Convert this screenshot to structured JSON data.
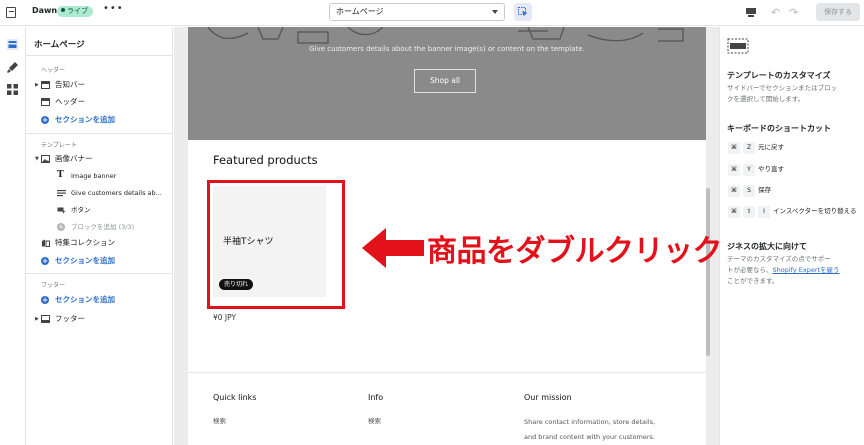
{
  "topbar": {
    "store_name": "Dawn",
    "status_badge": "ライブ",
    "more_label": "•••",
    "page_select": "ホームページ",
    "undo": "↶",
    "redo": "↷",
    "save_label": "保存する"
  },
  "sidebar": {
    "title": "ホームページ",
    "header_group": "ヘッダー",
    "header_items": [
      "告知バー",
      "ヘッダー"
    ],
    "add_section": "セクションを追加",
    "template_group": "テンプレート",
    "image_banner": "画像バナー",
    "banner_children": [
      "Image banner",
      "Give customers details ab...",
      "ボタン"
    ],
    "add_block": "ブロックを追加 (3/3)",
    "featured_collection": "特集コレクション",
    "add_section_2": "セクションを追加",
    "footer_group": "フッター",
    "add_section_3": "セクションを追加",
    "footer_item": "フッター"
  },
  "preview": {
    "banner_text": "Give customers details about the banner image(s) or content on the template.",
    "banner_button": "Shop all",
    "featured_title": "Featured products",
    "product_name": "半袖Tシャツ",
    "sold_out": "売り切れ",
    "price": "¥0 JPY",
    "footer": {
      "quick_links_title": "Quick links",
      "quick_links_item": "検索",
      "info_title": "Info",
      "info_item": "検索",
      "mission_title": "Our mission",
      "mission_line1": "Share contact information, store details,",
      "mission_line2": "and brand content with your customers."
    }
  },
  "annotation": {
    "text": "商品をダブルクリック",
    "color": "#e3121a"
  },
  "right_panel": {
    "customize_title": "テンプレートのカスタマイズ",
    "customize_text_1": "サイドバーでセクションまたはブロッ",
    "customize_text_2": "クを選択して開始します。",
    "shortcuts_title": "キーボードのショートカット",
    "shortcuts": [
      {
        "keys": [
          "⌘",
          "Z"
        ],
        "label": "元に戻す"
      },
      {
        "keys": [
          "⌘",
          "Y"
        ],
        "label": "やり直す"
      },
      {
        "keys": [
          "⌘",
          "S"
        ],
        "label": "保存"
      },
      {
        "keys": [
          "⌘",
          "⇧",
          "I"
        ],
        "label": "インスペクターを切り替える"
      }
    ],
    "business_title": "ジネスの拡大に向けて",
    "business_text_1": "テーマのカスタマイズの点でサポー",
    "business_text_2": "トが必要なら、",
    "expert_link": "Shopify Expertを雇う",
    "business_text_3": "ことができます。"
  },
  "colors": {
    "accent": "#2c6ecb",
    "badge": "#aee9d1",
    "annotation": "#e3121a"
  }
}
